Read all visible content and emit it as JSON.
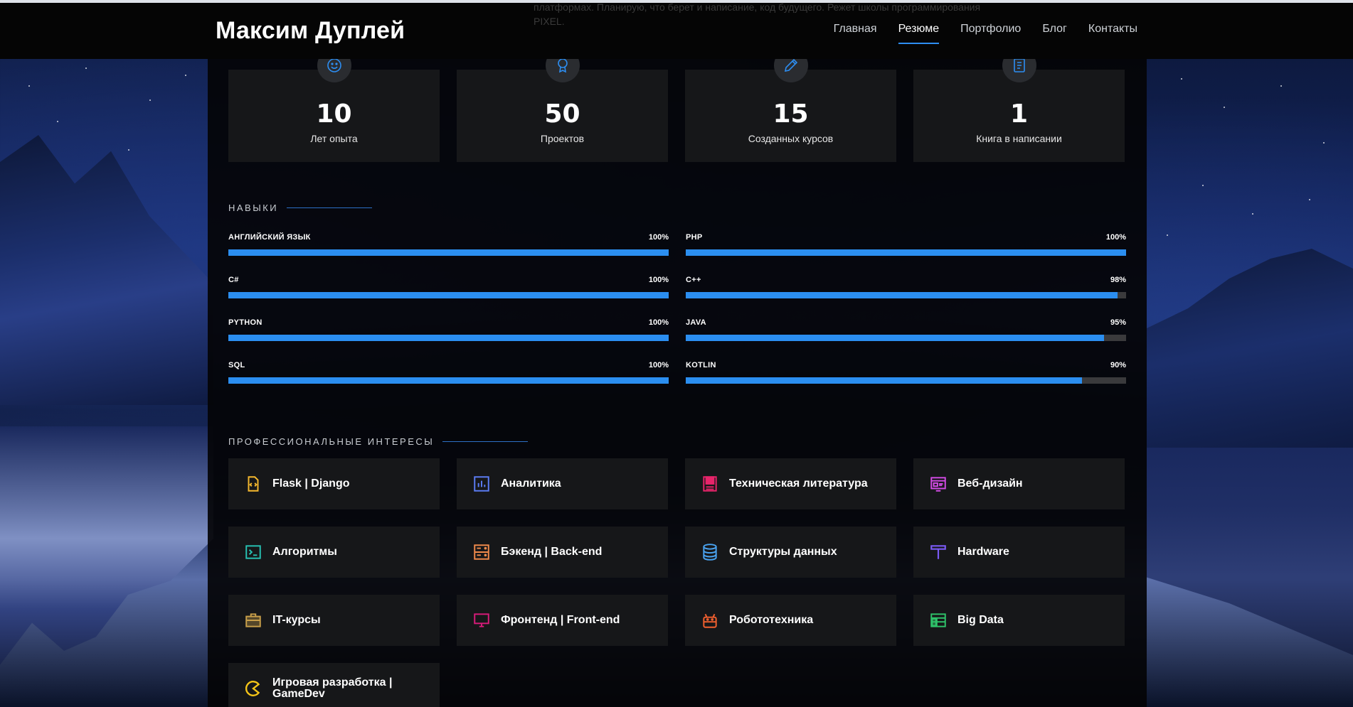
{
  "header": {
    "brand": "Максим Дуплей",
    "overflow_text_line1": "платформах. Планирую, что берет и написание, код будущего. Режет школы программирования",
    "overflow_text_line2": "PIXEL.",
    "nav": [
      {
        "label": "Главная",
        "active": false
      },
      {
        "label": "Резюме",
        "active": true
      },
      {
        "label": "Портфолио",
        "active": false
      },
      {
        "label": "Блог",
        "active": false
      },
      {
        "label": "Контакты",
        "active": false
      }
    ]
  },
  "stats": [
    {
      "icon": "smile-icon",
      "value": "10",
      "label": "Лет опыта"
    },
    {
      "icon": "award-icon",
      "value": "50",
      "label": "Проектов"
    },
    {
      "icon": "pencil-icon",
      "value": "15",
      "label": "Созданных курсов"
    },
    {
      "icon": "notebook-icon",
      "value": "1",
      "label": "Книга в написании"
    }
  ],
  "skills": {
    "title": "НАВЫКИ",
    "items": [
      {
        "name": "АНГЛИЙСКИЙ ЯЗЫК",
        "percent_label": "100%",
        "percent": 100
      },
      {
        "name": "PHP",
        "percent_label": "100%",
        "percent": 100
      },
      {
        "name": "C#",
        "percent_label": "100%",
        "percent": 100
      },
      {
        "name": "C++",
        "percent_label": "98%",
        "percent": 98
      },
      {
        "name": "PYTHON",
        "percent_label": "100%",
        "percent": 100
      },
      {
        "name": "JAVA",
        "percent_label": "95%",
        "percent": 95
      },
      {
        "name": "SQL",
        "percent_label": "100%",
        "percent": 100
      },
      {
        "name": "KOTLIN",
        "percent_label": "90%",
        "percent": 90
      }
    ]
  },
  "interests": {
    "title": "ПРОФЕССИОНАЛЬНЫЕ ИНТЕРЕСЫ",
    "items": [
      {
        "label": "Flask | Django",
        "icon": "code-file-icon",
        "color": "#f5b82e"
      },
      {
        "label": "Аналитика",
        "icon": "bar-chart-icon",
        "color": "#5b7cf5"
      },
      {
        "label": "Техническая литература",
        "icon": "book-icon",
        "color": "#e8246a"
      },
      {
        "label": "Веб-дизайн",
        "icon": "web-design-icon",
        "color": "#d34be5"
      },
      {
        "label": "Алгоритмы",
        "icon": "terminal-icon",
        "color": "#27c2b3"
      },
      {
        "label": "Бэкенд | Back-end",
        "icon": "server-icon",
        "color": "#f08a4b"
      },
      {
        "label": "Структуры данных",
        "icon": "database-icon",
        "color": "#4aa3f0"
      },
      {
        "label": "Hardware",
        "icon": "hammer-icon",
        "color": "#7a5af5"
      },
      {
        "label": "IT-курсы",
        "icon": "briefcase-icon",
        "color": "#c9a04a"
      },
      {
        "label": "Фронтенд | Front-end",
        "icon": "monitor-icon",
        "color": "#d81b7a"
      },
      {
        "label": "Робототехника",
        "icon": "robot-icon",
        "color": "#f2602f"
      },
      {
        "label": "Big Data",
        "icon": "spreadsheet-icon",
        "color": "#2fc36a"
      },
      {
        "label": "Игровая разработка | GameDev",
        "icon": "pacman-icon",
        "color": "#f5c518"
      }
    ]
  }
}
